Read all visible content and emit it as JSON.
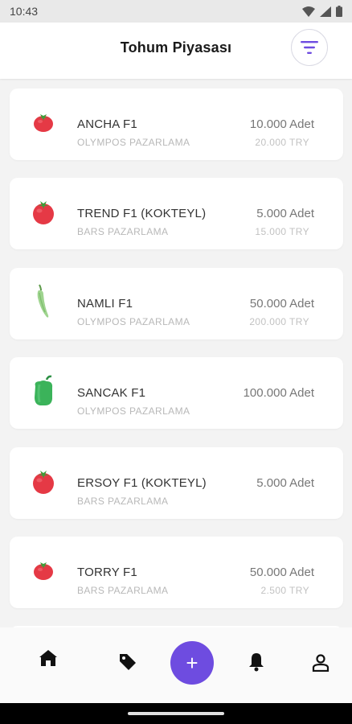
{
  "status_bar": {
    "time": "10:43"
  },
  "header": {
    "title": "Tohum Piyasası"
  },
  "colors": {
    "accent": "#6e4ce0",
    "tomato": "#e53945",
    "pepper_green": "#3bb35a"
  },
  "items": [
    {
      "icon": "tomato-icon",
      "name": "ANCHA F1",
      "company": "OLYMPOS PAZARLAMA",
      "quantity": "10.000 Adet",
      "price": "20.000 TRY"
    },
    {
      "icon": "tomato-icon",
      "name": "TREND F1 (KOKTEYL)",
      "company": "BARS PAZARLAMA",
      "quantity": "5.000 Adet",
      "price": "15.000 TRY"
    },
    {
      "icon": "chili-pepper-icon",
      "name": "NAMLI F1",
      "company": "OLYMPOS PAZARLAMA",
      "quantity": "50.000 Adet",
      "price": "200.000 TRY"
    },
    {
      "icon": "bell-pepper-icon",
      "name": "SANCAK F1",
      "company": "OLYMPOS PAZARLAMA",
      "quantity": "100.000 Adet",
      "price": ""
    },
    {
      "icon": "tomato-icon",
      "name": "ERSOY F1 (KOKTEYL)",
      "company": "BARS PAZARLAMA",
      "quantity": "5.000 Adet",
      "price": ""
    },
    {
      "icon": "tomato-icon",
      "name": "TORRY F1",
      "company": "BARS PAZARLAMA",
      "quantity": "50.000 Adet",
      "price": "2.500 TRY"
    }
  ],
  "bottom_nav": {
    "items": [
      "home-icon",
      "tag-icon",
      "add-icon",
      "bell-icon",
      "profile-icon"
    ],
    "fab_label": "+"
  }
}
